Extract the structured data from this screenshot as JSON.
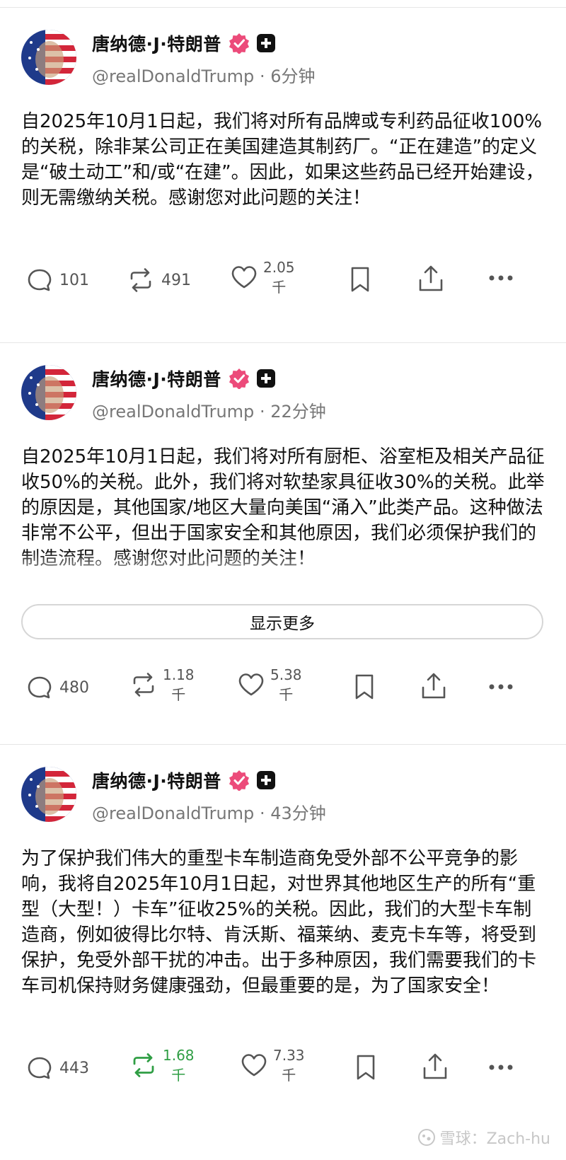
{
  "posts": [
    {
      "author_name": "唐纳德·J·特朗普",
      "handle": "@realDonaldTrump",
      "separator": "·",
      "time": "6分钟",
      "body": "自2025年10月1日起，我们将对所有品牌或专利药品征收100%的关税，除非某公司正在美国建造其制药厂。“正在建造”的定义是“破土动工”和/或“在建”。因此，如果这些药品已经开始建设，则无需缴纳关税。感谢您对此问题的关注！",
      "replies": "101",
      "reposts": "491",
      "likes_num": "2.05",
      "likes_unit": "千"
    },
    {
      "author_name": "唐纳德·J·特朗普",
      "handle": "@realDonaldTrump",
      "separator": "·",
      "time": "22分钟",
      "body": "自2025年10月1日起，我们将对所有厨柜、浴室柜及相关产品征收50%的关税。此外，我们将对软垫家具征收30%的关税。此举的原因是，其他国家/地区大量向美国“涌入”此类产品。这种做法非常不公平，但出于国家安全和其他原因，我们必须保护我们的制造流程。感谢您对此问题的关注！",
      "show_more": "显示更多",
      "replies": "480",
      "reposts_num": "1.18",
      "reposts_unit": "千",
      "likes_num": "5.38",
      "likes_unit": "千"
    },
    {
      "author_name": "唐纳德·J·特朗普",
      "handle": "@realDonaldTrump",
      "separator": "·",
      "time": "43分钟",
      "body": "为了保护我们伟大的重型卡车制造商免受外部不公平竞争的影响，我将自2025年10月1日起，对世界其他地区生产的所有“重型（大型！）卡车”征收25%的关税。因此，我们的大型卡车制造商，例如彼得比尔特、肯沃斯、福莱纳、麦克卡车等，将受到保护，免受外部干扰的冲击。出于多种原因，我们需要我们的卡车司机保持财务健康强劲，但最重要的是，为了国家安全！",
      "replies": "443",
      "reposts_num": "1.68",
      "reposts_unit": "千",
      "likes_num": "7.33",
      "likes_unit": "千"
    }
  ],
  "watermark": "雪球：Zach-hu",
  "colors": {
    "verified_badge": "#ec4b7a",
    "reposted_green": "#2f9e44",
    "divider": "#e6e6e6",
    "secondary_text": "#777777"
  },
  "icons": [
    "reply-icon",
    "repost-icon",
    "like-icon",
    "bookmark-icon",
    "share-icon",
    "more-icon",
    "verified-icon",
    "plus-icon"
  ]
}
